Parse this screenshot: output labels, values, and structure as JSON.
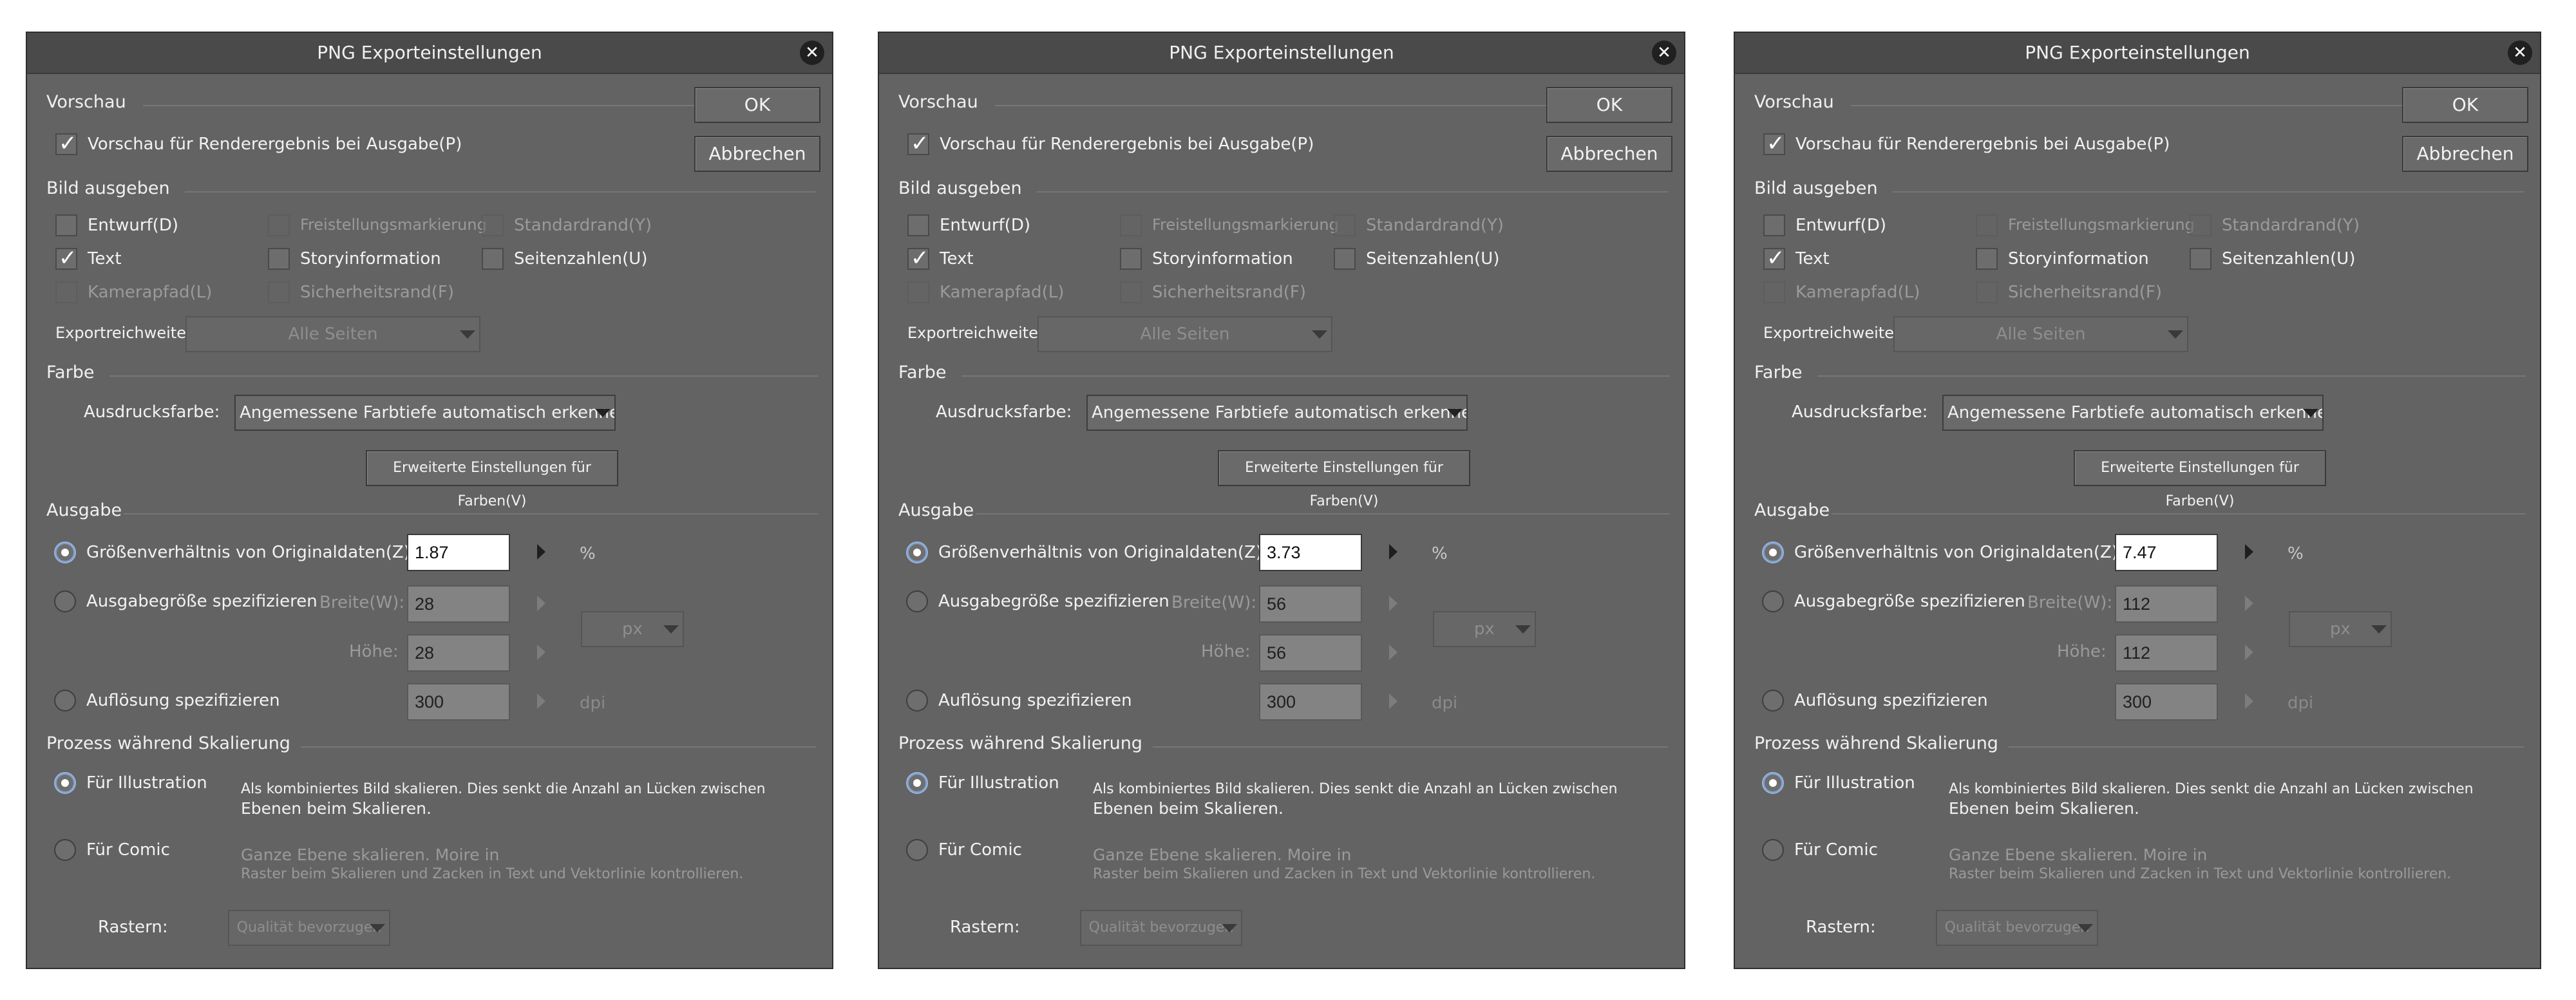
{
  "dialogs": [
    {
      "title": "PNG Exporteinstellungen",
      "ok": "OK",
      "cancel": "Abbrechen",
      "sections": {
        "preview": "Vorschau",
        "output_image": "Bild ausgeben",
        "color": "Farbe",
        "output": "Ausgabe",
        "process": "Prozess während Skalierung"
      },
      "preview_checkbox": "Vorschau für Renderergebnis bei Ausgabe(P)",
      "checkboxes": {
        "draft": "Entwurf(D)",
        "crop_marks": "Freistellungsmarkierung",
        "default_border": "Standardrand(Y)",
        "text": "Text",
        "story_info": "Storyinformation",
        "page_numbers": "Seitenzahlen(U)",
        "camera_path": "Kamerapfad(L)",
        "safety_border": "Sicherheitsrand(F)"
      },
      "export_range_label": "Exportreichweite:",
      "export_range_value": "Alle Seiten",
      "print_color_label": "Ausdrucksfarbe:",
      "print_color_value": "Angemessene Farbtiefe automatisch erkennen",
      "advanced_color_button": "Erweiterte Einstellungen für Farben(V)",
      "ratio_label": "Größenverhältnis von Originaldaten(Z)",
      "ratio_value": "1.87",
      "ratio_unit": "%",
      "size_label": "Ausgabegröße spezifizieren",
      "width_label": "Breite(W):",
      "width_value": "28",
      "height_label": "Höhe:",
      "height_value": "28",
      "size_unit": "px",
      "resolution_label": "Auflösung spezifizieren",
      "resolution_value": "300",
      "resolution_unit": "dpi",
      "for_illustration": "Für Illustration",
      "illustration_desc_1": "Als kombiniertes Bild skalieren. Dies senkt die Anzahl an Lücken zwischen",
      "illustration_desc_2": "Ebenen beim Skalieren.",
      "for_comic": "Für Comic",
      "comic_desc_1": "Ganze Ebene skalieren. Moire in",
      "comic_desc_2": "Raster beim Skalieren und Zacken in Text und Vektorlinie kontrollieren.",
      "raster_label": "Rastern:",
      "raster_value": "Qualität bevorzugen"
    },
    {
      "title": "PNG Exporteinstellungen",
      "ok": "OK",
      "cancel": "Abbrechen",
      "sections": {
        "preview": "Vorschau",
        "output_image": "Bild ausgeben",
        "color": "Farbe",
        "output": "Ausgabe",
        "process": "Prozess während Skalierung"
      },
      "preview_checkbox": "Vorschau für Renderergebnis bei Ausgabe(P)",
      "checkboxes": {
        "draft": "Entwurf(D)",
        "crop_marks": "Freistellungsmarkierung",
        "default_border": "Standardrand(Y)",
        "text": "Text",
        "story_info": "Storyinformation",
        "page_numbers": "Seitenzahlen(U)",
        "camera_path": "Kamerapfad(L)",
        "safety_border": "Sicherheitsrand(F)"
      },
      "export_range_label": "Exportreichweite:",
      "export_range_value": "Alle Seiten",
      "print_color_label": "Ausdrucksfarbe:",
      "print_color_value": "Angemessene Farbtiefe automatisch erkennen",
      "advanced_color_button": "Erweiterte Einstellungen für Farben(V)",
      "ratio_label": "Größenverhältnis von Originaldaten(Z)",
      "ratio_value": "3.73",
      "ratio_unit": "%",
      "size_label": "Ausgabegröße spezifizieren",
      "width_label": "Breite(W):",
      "width_value": "56",
      "height_label": "Höhe:",
      "height_value": "56",
      "size_unit": "px",
      "resolution_label": "Auflösung spezifizieren",
      "resolution_value": "300",
      "resolution_unit": "dpi",
      "for_illustration": "Für Illustration",
      "illustration_desc_1": "Als kombiniertes Bild skalieren. Dies senkt die Anzahl an Lücken zwischen",
      "illustration_desc_2": "Ebenen beim Skalieren.",
      "for_comic": "Für Comic",
      "comic_desc_1": "Ganze Ebene skalieren. Moire in",
      "comic_desc_2": "Raster beim Skalieren und Zacken in Text und Vektorlinie kontrollieren.",
      "raster_label": "Rastern:",
      "raster_value": "Qualität bevorzugen"
    },
    {
      "title": "PNG Exporteinstellungen",
      "ok": "OK",
      "cancel": "Abbrechen",
      "sections": {
        "preview": "Vorschau",
        "output_image": "Bild ausgeben",
        "color": "Farbe",
        "output": "Ausgabe",
        "process": "Prozess während Skalierung"
      },
      "preview_checkbox": "Vorschau für Renderergebnis bei Ausgabe(P)",
      "checkboxes": {
        "draft": "Entwurf(D)",
        "crop_marks": "Freistellungsmarkierung",
        "default_border": "Standardrand(Y)",
        "text": "Text",
        "story_info": "Storyinformation",
        "page_numbers": "Seitenzahlen(U)",
        "camera_path": "Kamerapfad(L)",
        "safety_border": "Sicherheitsrand(F)"
      },
      "export_range_label": "Exportreichweite:",
      "export_range_value": "Alle Seiten",
      "print_color_label": "Ausdrucksfarbe:",
      "print_color_value": "Angemessene Farbtiefe automatisch erkennen",
      "advanced_color_button": "Erweiterte Einstellungen für Farben(V)",
      "ratio_label": "Größenverhältnis von Originaldaten(Z)",
      "ratio_value": "7.47",
      "ratio_unit": "%",
      "size_label": "Ausgabegröße spezifizieren",
      "width_label": "Breite(W):",
      "width_value": "112",
      "height_label": "Höhe:",
      "height_value": "112",
      "size_unit": "px",
      "resolution_label": "Auflösung spezifizieren",
      "resolution_value": "300",
      "resolution_unit": "dpi",
      "for_illustration": "Für Illustration",
      "illustration_desc_1": "Als kombiniertes Bild skalieren. Dies senkt die Anzahl an Lücken zwischen",
      "illustration_desc_2": "Ebenen beim Skalieren.",
      "for_comic": "Für Comic",
      "comic_desc_1": "Ganze Ebene skalieren. Moire in",
      "comic_desc_2": "Raster beim Skalieren und Zacken in Text und Vektorlinie kontrollieren.",
      "raster_label": "Rastern:",
      "raster_value": "Qualität bevorzugen"
    }
  ]
}
